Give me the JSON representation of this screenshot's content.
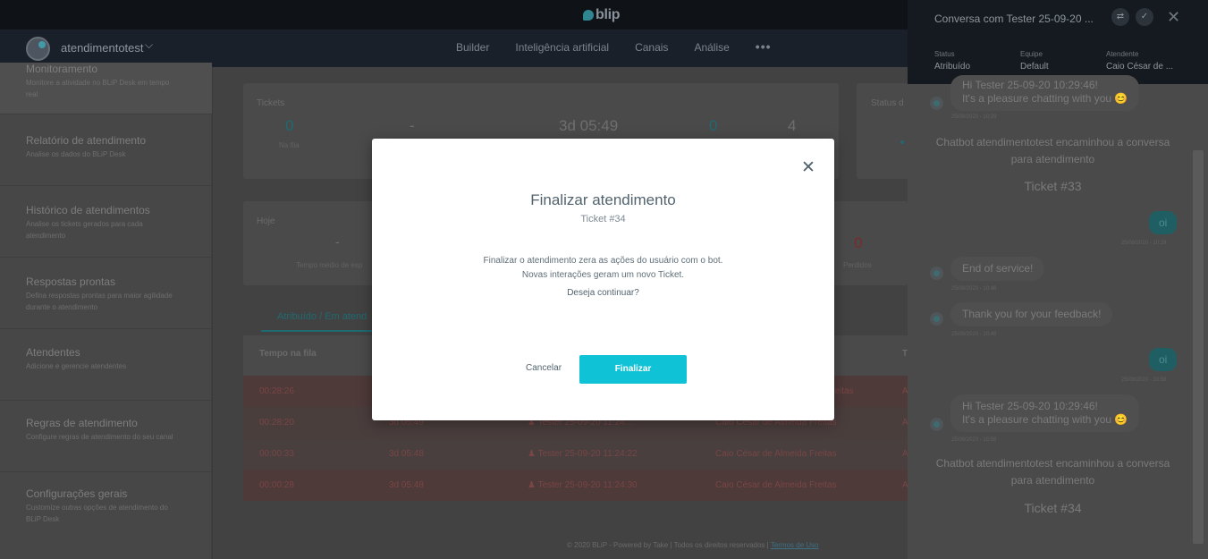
{
  "app": {
    "logo_text": "blip"
  },
  "bot": {
    "name": "atendimentotest",
    "chevron": "chevron-down-icon"
  },
  "nav": {
    "items": [
      "Builder",
      "Inteligência artificial",
      "Canais",
      "Análise"
    ],
    "more": "•••"
  },
  "sidebar": {
    "items": [
      {
        "title": "Monitoramento",
        "desc": "Monitore a atividade no BLiP Desk em tempo real"
      },
      {
        "title": "Relatório de atendimento",
        "desc": "Analise os dados do BLiP Desk"
      },
      {
        "title": "Histórico de atendimentos",
        "desc": "Analise os tickets gerados para cada atendimento"
      },
      {
        "title": "Respostas prontas",
        "desc": "Defina respostas prontas para maior agilidade durante o atendimento"
      },
      {
        "title": "Atendentes",
        "desc": "Adicione e gerencie atendentes"
      },
      {
        "title": "Regras de atendimento",
        "desc": "Configure regras de atendimento do seu canal"
      },
      {
        "title": "Configurações gerais",
        "desc": "Customize outras opções de atendimento do BLiP Desk"
      }
    ]
  },
  "tickets": {
    "label": "Tickets",
    "queue_value": "0",
    "queue_label": "Na fila",
    "dash": "-",
    "time": "3d 05:49",
    "v3": "0",
    "v4": "4",
    "status_label": "Status d"
  },
  "today": {
    "label": "Hoje",
    "dash": "-",
    "avg_label": "Tempo médio de esp",
    "lost_value": "0",
    "lost_label": "Perdidos"
  },
  "tab": {
    "label": "Atribuído / Em atend"
  },
  "table": {
    "headers": [
      "Tempo na fila",
      "T"
    ],
    "rows": [
      {
        "c1": "00:28:26",
        "c2": "",
        "c3": "",
        "c4": "",
        "c5": "A"
      },
      {
        "c1": "00:28:20",
        "c2": "3d 05:49",
        "c3": "Tester 25-09-20 11:24:...",
        "c4": "Caio César de Almeida Freitas",
        "c5": "A"
      },
      {
        "c1": "00:00:33",
        "c2": "3d 05:48",
        "c3": "Tester 25-09-20 11:24:22",
        "c4": "Caio César de Almeida Freitas",
        "c5": "A"
      },
      {
        "c1": "00:00:28",
        "c2": "3d 05:48",
        "c3": "Tester 25-09-20 11:24:30",
        "c4": "Caio César de Almeida Freitas",
        "c5": "A"
      }
    ],
    "row1_partial": "Freitas"
  },
  "footer": {
    "text": "© 2020 BLiP - Powered by Take | Todos os direitos reservados | ",
    "link": "Termos de Uso"
  },
  "conversation": {
    "title": "Conversa com Tester 25-09-20 ...",
    "status_label": "Status",
    "status_value": "Atribuído",
    "team_label": "Equipe",
    "team_value": "Default",
    "agent_label": "Atendente",
    "agent_value": "Caio César de ...",
    "messages": [
      {
        "text1": "Hi Tester 25-09-20 10:29:46!",
        "text2": "It's a pleasure chatting with you 😊",
        "time": "25/09/2020 - 10:29"
      },
      {
        "system": "Chatbot atendimentotest encaminhou a conversa para atendimento",
        "ticket": "Ticket #33"
      },
      {
        "out": "oi",
        "time": "25/09/2020 - 10:29"
      },
      {
        "text": "End of service!",
        "time": "25/09/2020 - 10:48"
      },
      {
        "text": "Thank you for your feedback!",
        "time": "25/09/2020 - 10:48"
      },
      {
        "out": "oi",
        "time": "25/09/2020 - 10:58"
      },
      {
        "text1": "Hi Tester 25-09-20 10:29:46!",
        "text2": "It's a pleasure chatting with you 😊",
        "time": "25/09/2020 - 10:58"
      },
      {
        "system": "Chatbot atendimentotest encaminhou a conversa para atendimento",
        "ticket": "Ticket #34"
      }
    ]
  },
  "modal": {
    "title": "Finalizar atendimento",
    "subtitle": "Ticket #34",
    "body1": "Finalizar o atendimento zera as ações do usuário com o bot.",
    "body2": "Novas interações geram um novo Ticket.",
    "question": "Deseja continuar?",
    "cancel": "Cancelar",
    "confirm": "Finalizar",
    "close_icon": "close-icon"
  }
}
